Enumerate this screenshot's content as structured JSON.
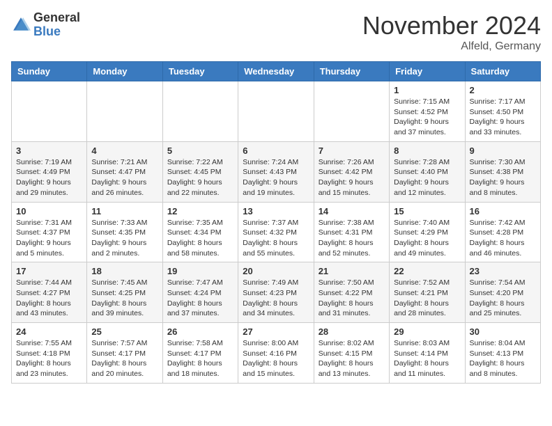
{
  "logo": {
    "general": "General",
    "blue": "Blue"
  },
  "header": {
    "month": "November 2024",
    "location": "Alfeld, Germany"
  },
  "weekdays": [
    "Sunday",
    "Monday",
    "Tuesday",
    "Wednesday",
    "Thursday",
    "Friday",
    "Saturday"
  ],
  "weeks": [
    [
      {
        "day": "",
        "info": ""
      },
      {
        "day": "",
        "info": ""
      },
      {
        "day": "",
        "info": ""
      },
      {
        "day": "",
        "info": ""
      },
      {
        "day": "",
        "info": ""
      },
      {
        "day": "1",
        "info": "Sunrise: 7:15 AM\nSunset: 4:52 PM\nDaylight: 9 hours\nand 37 minutes."
      },
      {
        "day": "2",
        "info": "Sunrise: 7:17 AM\nSunset: 4:50 PM\nDaylight: 9 hours\nand 33 minutes."
      }
    ],
    [
      {
        "day": "3",
        "info": "Sunrise: 7:19 AM\nSunset: 4:49 PM\nDaylight: 9 hours\nand 29 minutes."
      },
      {
        "day": "4",
        "info": "Sunrise: 7:21 AM\nSunset: 4:47 PM\nDaylight: 9 hours\nand 26 minutes."
      },
      {
        "day": "5",
        "info": "Sunrise: 7:22 AM\nSunset: 4:45 PM\nDaylight: 9 hours\nand 22 minutes."
      },
      {
        "day": "6",
        "info": "Sunrise: 7:24 AM\nSunset: 4:43 PM\nDaylight: 9 hours\nand 19 minutes."
      },
      {
        "day": "7",
        "info": "Sunrise: 7:26 AM\nSunset: 4:42 PM\nDaylight: 9 hours\nand 15 minutes."
      },
      {
        "day": "8",
        "info": "Sunrise: 7:28 AM\nSunset: 4:40 PM\nDaylight: 9 hours\nand 12 minutes."
      },
      {
        "day": "9",
        "info": "Sunrise: 7:30 AM\nSunset: 4:38 PM\nDaylight: 9 hours\nand 8 minutes."
      }
    ],
    [
      {
        "day": "10",
        "info": "Sunrise: 7:31 AM\nSunset: 4:37 PM\nDaylight: 9 hours\nand 5 minutes."
      },
      {
        "day": "11",
        "info": "Sunrise: 7:33 AM\nSunset: 4:35 PM\nDaylight: 9 hours\nand 2 minutes."
      },
      {
        "day": "12",
        "info": "Sunrise: 7:35 AM\nSunset: 4:34 PM\nDaylight: 8 hours\nand 58 minutes."
      },
      {
        "day": "13",
        "info": "Sunrise: 7:37 AM\nSunset: 4:32 PM\nDaylight: 8 hours\nand 55 minutes."
      },
      {
        "day": "14",
        "info": "Sunrise: 7:38 AM\nSunset: 4:31 PM\nDaylight: 8 hours\nand 52 minutes."
      },
      {
        "day": "15",
        "info": "Sunrise: 7:40 AM\nSunset: 4:29 PM\nDaylight: 8 hours\nand 49 minutes."
      },
      {
        "day": "16",
        "info": "Sunrise: 7:42 AM\nSunset: 4:28 PM\nDaylight: 8 hours\nand 46 minutes."
      }
    ],
    [
      {
        "day": "17",
        "info": "Sunrise: 7:44 AM\nSunset: 4:27 PM\nDaylight: 8 hours\nand 43 minutes."
      },
      {
        "day": "18",
        "info": "Sunrise: 7:45 AM\nSunset: 4:25 PM\nDaylight: 8 hours\nand 39 minutes."
      },
      {
        "day": "19",
        "info": "Sunrise: 7:47 AM\nSunset: 4:24 PM\nDaylight: 8 hours\nand 37 minutes."
      },
      {
        "day": "20",
        "info": "Sunrise: 7:49 AM\nSunset: 4:23 PM\nDaylight: 8 hours\nand 34 minutes."
      },
      {
        "day": "21",
        "info": "Sunrise: 7:50 AM\nSunset: 4:22 PM\nDaylight: 8 hours\nand 31 minutes."
      },
      {
        "day": "22",
        "info": "Sunrise: 7:52 AM\nSunset: 4:21 PM\nDaylight: 8 hours\nand 28 minutes."
      },
      {
        "day": "23",
        "info": "Sunrise: 7:54 AM\nSunset: 4:20 PM\nDaylight: 8 hours\nand 25 minutes."
      }
    ],
    [
      {
        "day": "24",
        "info": "Sunrise: 7:55 AM\nSunset: 4:18 PM\nDaylight: 8 hours\nand 23 minutes."
      },
      {
        "day": "25",
        "info": "Sunrise: 7:57 AM\nSunset: 4:17 PM\nDaylight: 8 hours\nand 20 minutes."
      },
      {
        "day": "26",
        "info": "Sunrise: 7:58 AM\nSunset: 4:17 PM\nDaylight: 8 hours\nand 18 minutes."
      },
      {
        "day": "27",
        "info": "Sunrise: 8:00 AM\nSunset: 4:16 PM\nDaylight: 8 hours\nand 15 minutes."
      },
      {
        "day": "28",
        "info": "Sunrise: 8:02 AM\nSunset: 4:15 PM\nDaylight: 8 hours\nand 13 minutes."
      },
      {
        "day": "29",
        "info": "Sunrise: 8:03 AM\nSunset: 4:14 PM\nDaylight: 8 hours\nand 11 minutes."
      },
      {
        "day": "30",
        "info": "Sunrise: 8:04 AM\nSunset: 4:13 PM\nDaylight: 8 hours\nand 8 minutes."
      }
    ]
  ]
}
